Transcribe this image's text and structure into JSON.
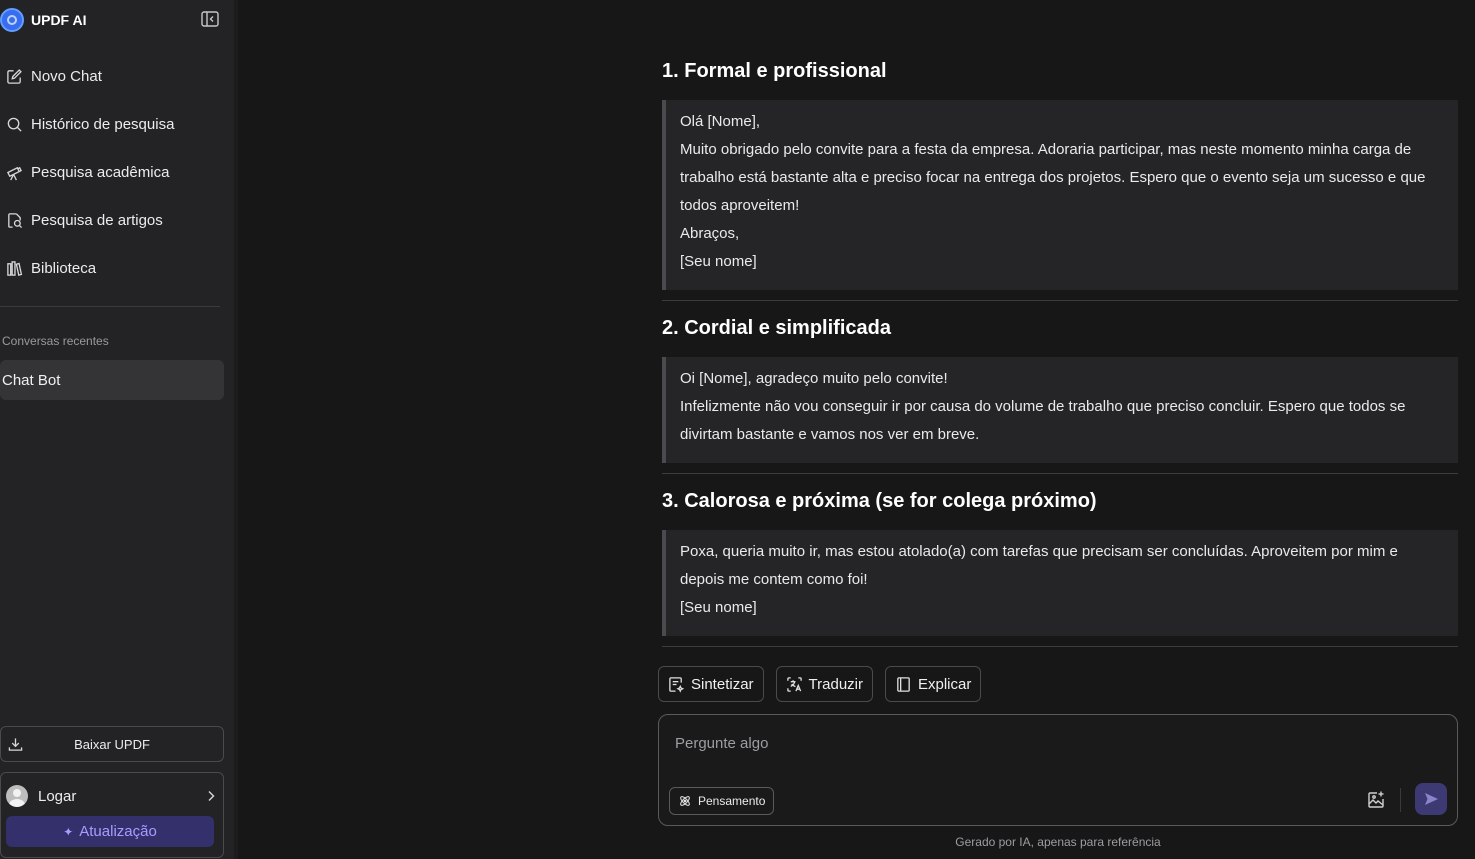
{
  "sidebar": {
    "brand": "UPDF AI",
    "nav": [
      {
        "label": "Novo Chat",
        "icon": "edit-icon"
      },
      {
        "label": "Histórico de pesquisa",
        "icon": "search-icon"
      },
      {
        "label": "Pesquisa acadêmica",
        "icon": "telescope-icon"
      },
      {
        "label": "Pesquisa de artigos",
        "icon": "document-search-icon"
      },
      {
        "label": "Biblioteca",
        "icon": "library-icon"
      }
    ],
    "recent_title": "Conversas recentes",
    "recent_items": [
      "Chat Bot"
    ],
    "download_label": "Baixar UPDF",
    "login_label": "Logar",
    "upgrade_label": "Atualização"
  },
  "main": {
    "sections": [
      {
        "title": "1. Formal e profissional",
        "lines": [
          "Olá [Nome],",
          "Muito obrigado pelo convite para a festa da empresa. Adoraria participar, mas neste momento minha carga de",
          "trabalho está bastante alta e preciso focar na entrega dos projetos. Espero que o evento seja um sucesso e que",
          "todos aproveitem!",
          "Abraços,",
          "[Seu nome]"
        ]
      },
      {
        "title": "2. Cordial e simplificada",
        "lines": [
          "Oi [Nome], agradeço muito pelo convite!",
          "Infelizmente não vou conseguir ir por causa do volume de trabalho que preciso concluir. Espero que todos se",
          "divirtam bastante e vamos nos ver em breve."
        ]
      },
      {
        "title": "3. Calorosa e próxima (se for colega próximo)",
        "lines": [
          "Poxa, queria muito ir, mas estou atolado(a) com tarefas que precisam ser concluídas. Aproveitem por mim e",
          "depois me contem como foi!",
          "[Seu nome]"
        ]
      }
    ],
    "actions": [
      {
        "label": "Sintetizar",
        "icon": "summarize-icon"
      },
      {
        "label": "Traduzir",
        "icon": "translate-icon"
      },
      {
        "label": "Explicar",
        "icon": "book-icon"
      }
    ],
    "input": {
      "placeholder": "Pergunte algo",
      "value": "",
      "thinking_label": "Pensamento"
    },
    "footer_note": "Gerado por IA, apenas para referência"
  },
  "colors": {
    "background": "#171717",
    "sidebar": "#232325",
    "accent": "#a99cff",
    "upgrade_bg": "#33306b",
    "send_bg": "#3d3a73"
  }
}
